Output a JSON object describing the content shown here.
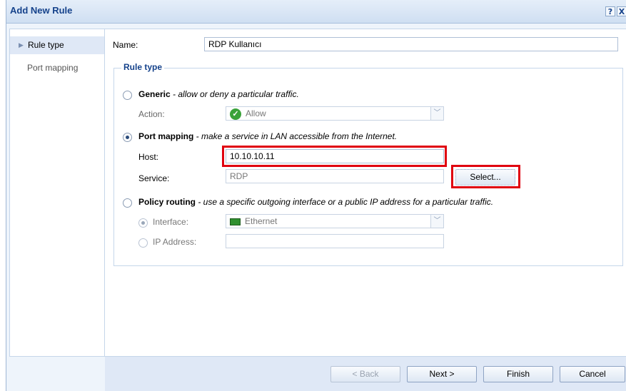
{
  "window": {
    "title": "Add New Rule",
    "help_glyph": "?",
    "close_glyph": "X"
  },
  "sidebar": {
    "items": [
      {
        "label": "Rule type"
      },
      {
        "label": "Port mapping"
      }
    ]
  },
  "form": {
    "name_label": "Name:",
    "name_value": "RDP Kullanıcı",
    "rule_type_legend": "Rule type",
    "generic": {
      "title": "Generic",
      "desc": " - allow or deny a particular traffic.",
      "action_label": "Action:",
      "action_value": "Allow"
    },
    "port_mapping": {
      "title": "Port mapping",
      "desc": " - make a service in LAN accessible from the Internet.",
      "host_label": "Host:",
      "host_value": "10.10.10.11",
      "service_label": "Service:",
      "service_value": "RDP",
      "select_label": "Select..."
    },
    "policy_routing": {
      "title": "Policy routing",
      "desc": " - use a specific outgoing interface or a public IP address for a particular traffic.",
      "interface_label": "Interface:",
      "interface_value": "Ethernet",
      "ip_label": "IP Address:",
      "ip_value": ""
    }
  },
  "footer": {
    "back_label": "< Back",
    "next_label": "Next >",
    "finish_label": "Finish",
    "cancel_label": "Cancel"
  },
  "colors": {
    "highlight": "#e0000f",
    "title_text": "#15428b"
  }
}
